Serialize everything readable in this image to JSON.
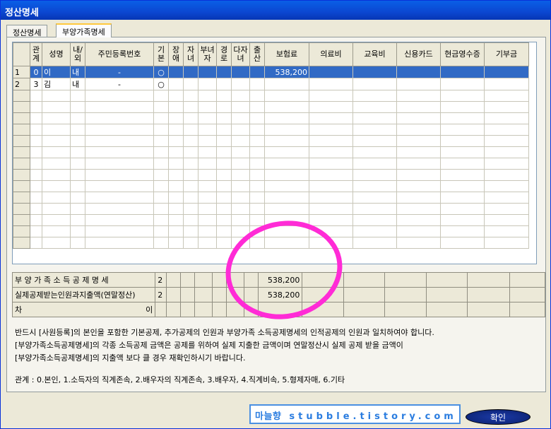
{
  "window": {
    "title": "정산명세"
  },
  "tabs": [
    {
      "label": "정산명세"
    },
    {
      "label": "부양가족명세"
    }
  ],
  "grid": {
    "headers": [
      "관계",
      "성명",
      "내/외",
      "주민등록번호",
      "기본",
      "장애",
      "자녀",
      "부녀자",
      "경로",
      "다자녀",
      "출산",
      "보험료",
      "의료비",
      "교육비",
      "신용카드",
      "현금영수증",
      "기부금"
    ],
    "rows": [
      {
        "no": "1",
        "rel": "0",
        "name": "이",
        "nat": "내",
        "reg": "-",
        "basic": "○",
        "insurance": "538,200"
      },
      {
        "no": "2",
        "rel": "3",
        "name": "김",
        "nat": "내",
        "reg": "-",
        "basic": "○",
        "insurance": ""
      }
    ]
  },
  "summary": [
    {
      "label": "부 양 가 족   소 득 공 제  명 세",
      "count": "2",
      "insurance": "538,200"
    },
    {
      "label": "실제공제받는인원과지출액(연말정산)",
      "count": "2",
      "insurance": "538,200"
    },
    {
      "label": "차",
      "count": "이",
      "insurance": ""
    }
  ],
  "notes": {
    "line1": "반드시 [사원등록]의 본인을 포함한 기본공제, 추가공제의 인원과 부양가족 소득공제명세의 인적공제의 인원과 일치하여야 합니다.",
    "line2": "[부양가족소득공제명세]의 각종 소득공제 금액은 공제를 위하여 실제 지출한 금액이며 연말정산시 실제 공제 받을 금액이",
    "line3": "[부양가족소득공제명세]의 지출액 보다 클 경우 재확인하시기 바랍니다."
  },
  "relation_legend": "관계 : 0.본인, 1.소득자의 직계존속, 2.배우자의 직계존속, 3.배우자, 4.직계비속, 5.형제자매, 6.기타",
  "watermark": {
    "name": "마늘향",
    "site": "stubble.tistory.com"
  },
  "buttons": {
    "confirm": "확인"
  },
  "colors": {
    "selection": "#316ac5",
    "title": "#0b47d1",
    "annotation_circle": "#ff2bd6"
  }
}
